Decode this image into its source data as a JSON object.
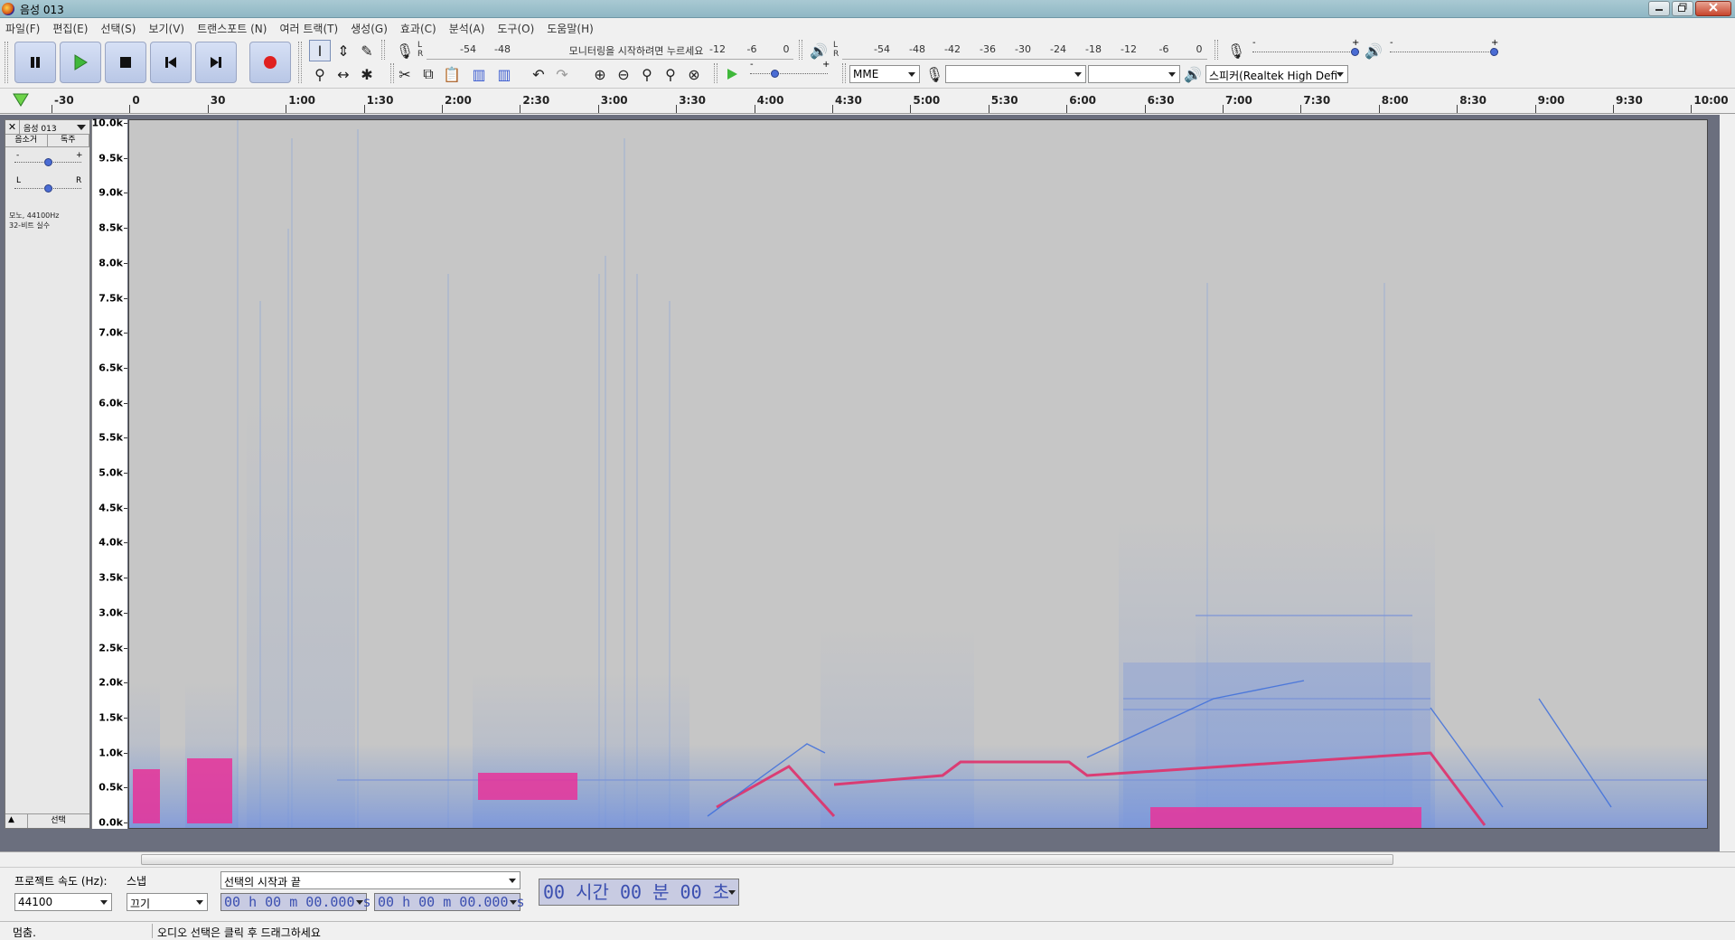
{
  "window": {
    "title": "음성 013",
    "min": "0",
    "max": "1",
    "close": "r"
  },
  "menu": [
    "파일(F)",
    "편집(E)",
    "선택(S)",
    "보기(V)",
    "트랜스포트 (N)",
    "여러 트랙(T)",
    "생성(G)",
    "효과(C)",
    "분석(A)",
    "도구(O)",
    "도움말(H)"
  ],
  "transport": {
    "pause": "pause",
    "play": "play",
    "stop": "stop",
    "skip_start": "skip-to-start",
    "skip_end": "skip-to-end",
    "record": "record"
  },
  "record_meter": {
    "lr": "L\nR",
    "ticks": [
      "-54",
      "-48",
      "-12",
      "-6",
      "0"
    ],
    "prompt": "모니터링을 시작하려면 누르세요"
  },
  "play_meter": {
    "lr": "L\nR",
    "ticks": [
      "-54",
      "-48",
      "-42",
      "-36",
      "-30",
      "-24",
      "-18",
      "-12",
      "-6",
      "0"
    ]
  },
  "mixer": {
    "rec_minus": "-",
    "rec_plus": "+",
    "play_minus": "-",
    "play_plus": "+",
    "rec_level": 1.0,
    "play_level": 1.0
  },
  "play_at_speed": {
    "minus": "-",
    "plus": "+",
    "level": 0.3
  },
  "devices": {
    "host": "MME",
    "rec_device": "",
    "rec_channels": "",
    "play_device": "스피커(Realtek High Defi"
  },
  "ruler": {
    "labels": [
      "-30",
      "0",
      "30",
      "1:00",
      "1:30",
      "2:00",
      "2:30",
      "3:00",
      "3:30",
      "4:00",
      "4:30",
      "5:00",
      "5:30",
      "6:00",
      "6:30",
      "7:00",
      "7:30",
      "8:00",
      "8:30",
      "9:00",
      "9:30",
      "10:00"
    ]
  },
  "track": {
    "name": "음성 013",
    "mute": "음소거",
    "solo": "독주",
    "gain_minus": "-",
    "gain_plus": "+",
    "pan_l": "L",
    "pan_r": "R",
    "gain_level": 0.5,
    "pan_level": 0.5,
    "info_line1": "모노, 44100Hz",
    "info_line2": "32-비트 실수",
    "select": "선택",
    "collapse": "▲"
  },
  "freq_axis": [
    "10.0k",
    "9.5k",
    "9.0k",
    "8.5k",
    "8.0k",
    "7.5k",
    "7.0k",
    "6.5k",
    "6.0k",
    "5.5k",
    "5.0k",
    "4.5k",
    "4.0k",
    "3.5k",
    "3.0k",
    "2.5k",
    "2.0k",
    "1.5k",
    "1.0k",
    "0.5k",
    "0.0k"
  ],
  "selection": {
    "rate_label": "프로젝트 속도 (Hz):",
    "rate_value": "44100",
    "snap_label": "스냅",
    "snap_value": "끄기",
    "mode": "선택의 시작과 끝",
    "start": "00 h 00 m 00.000 s",
    "end": "00 h 00 m 00.000 s",
    "audio_position": "00 시간 00 분 00 초"
  },
  "status": {
    "state": "멈춤.",
    "hint": "오디오 선택은 클릭 후 드래그하세요"
  }
}
